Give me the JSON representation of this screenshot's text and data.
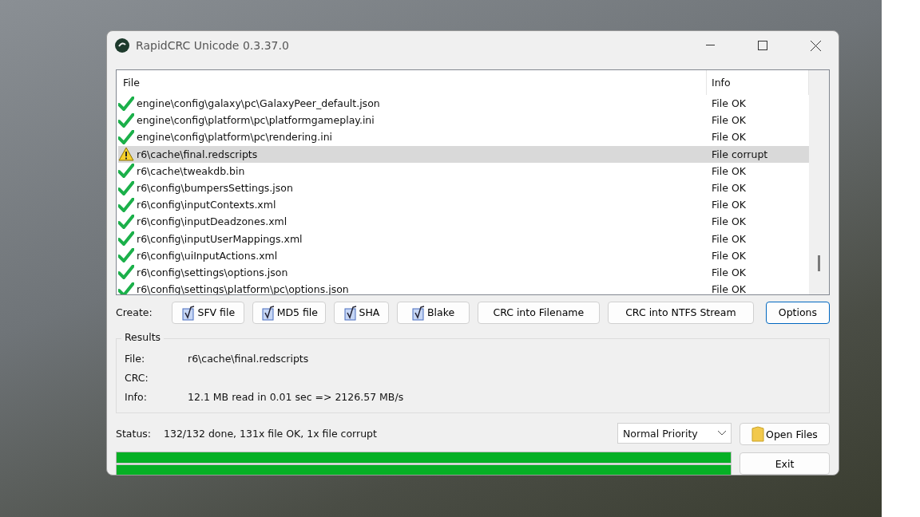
{
  "window": {
    "title": "RapidCRC Unicode 0.3.37.0"
  },
  "table": {
    "columns": [
      "File",
      "Info"
    ],
    "rows": [
      {
        "kind": "ok",
        "file": "engine\\config\\galaxy\\pc\\GalaxyPeer_default.json",
        "info": "File OK",
        "selected": false
      },
      {
        "kind": "ok",
        "file": "engine\\config\\platform\\pc\\platformgameplay.ini",
        "info": "File OK",
        "selected": false
      },
      {
        "kind": "ok",
        "file": "engine\\config\\platform\\pc\\rendering.ini",
        "info": "File OK",
        "selected": false
      },
      {
        "kind": "corrupt",
        "file": "r6\\cache\\final.redscripts",
        "info": "File corrupt",
        "selected": true
      },
      {
        "kind": "ok",
        "file": "r6\\cache\\tweakdb.bin",
        "info": "File OK",
        "selected": false
      },
      {
        "kind": "ok",
        "file": "r6\\config\\bumpersSettings.json",
        "info": "File OK",
        "selected": false
      },
      {
        "kind": "ok",
        "file": "r6\\config\\inputContexts.xml",
        "info": "File OK",
        "selected": false
      },
      {
        "kind": "ok",
        "file": "r6\\config\\inputDeadzones.xml",
        "info": "File OK",
        "selected": false
      },
      {
        "kind": "ok",
        "file": "r6\\config\\inputUserMappings.xml",
        "info": "File OK",
        "selected": false
      },
      {
        "kind": "ok",
        "file": "r6\\config\\uiInputActions.xml",
        "info": "File OK",
        "selected": false
      },
      {
        "kind": "ok",
        "file": "r6\\config\\settings\\options.json",
        "info": "File OK",
        "selected": false
      },
      {
        "kind": "ok",
        "file": "r6\\config\\settings\\platform\\pc\\options.json",
        "info": "File OK",
        "selected": false
      }
    ]
  },
  "create": {
    "label": "Create:",
    "buttons": [
      {
        "kind": "hash",
        "label": "SFV file",
        "focused": false
      },
      {
        "kind": "hash",
        "label": "MD5 file",
        "focused": false
      },
      {
        "kind": "hash",
        "label": "SHA",
        "focused": false
      },
      {
        "kind": "hash",
        "label": "Blake",
        "focused": false
      },
      {
        "kind": "plain",
        "label": "CRC into Filename",
        "focused": false
      },
      {
        "kind": "plain",
        "label": "CRC into NTFS Stream",
        "focused": false
      },
      {
        "kind": "plain",
        "label": "Options",
        "focused": true
      }
    ]
  },
  "results": {
    "title": "Results",
    "fields": [
      {
        "label": "File:",
        "value": "r6\\cache\\final.redscripts"
      },
      {
        "label": "CRC:"
      },
      {
        "label": "Info:",
        "value": "12.1 MB read in 0.01 sec => 2126.57 MB/s"
      }
    ]
  },
  "status": {
    "label": "Status:",
    "text": "132/132 done, 131x file OK, 1x file corrupt"
  },
  "priority": {
    "value": "Normal Priority"
  },
  "open_files": "Open Files",
  "exit": "Exit",
  "progress": [
    {
      "level": 1
    },
    {
      "level": 1
    }
  ]
}
